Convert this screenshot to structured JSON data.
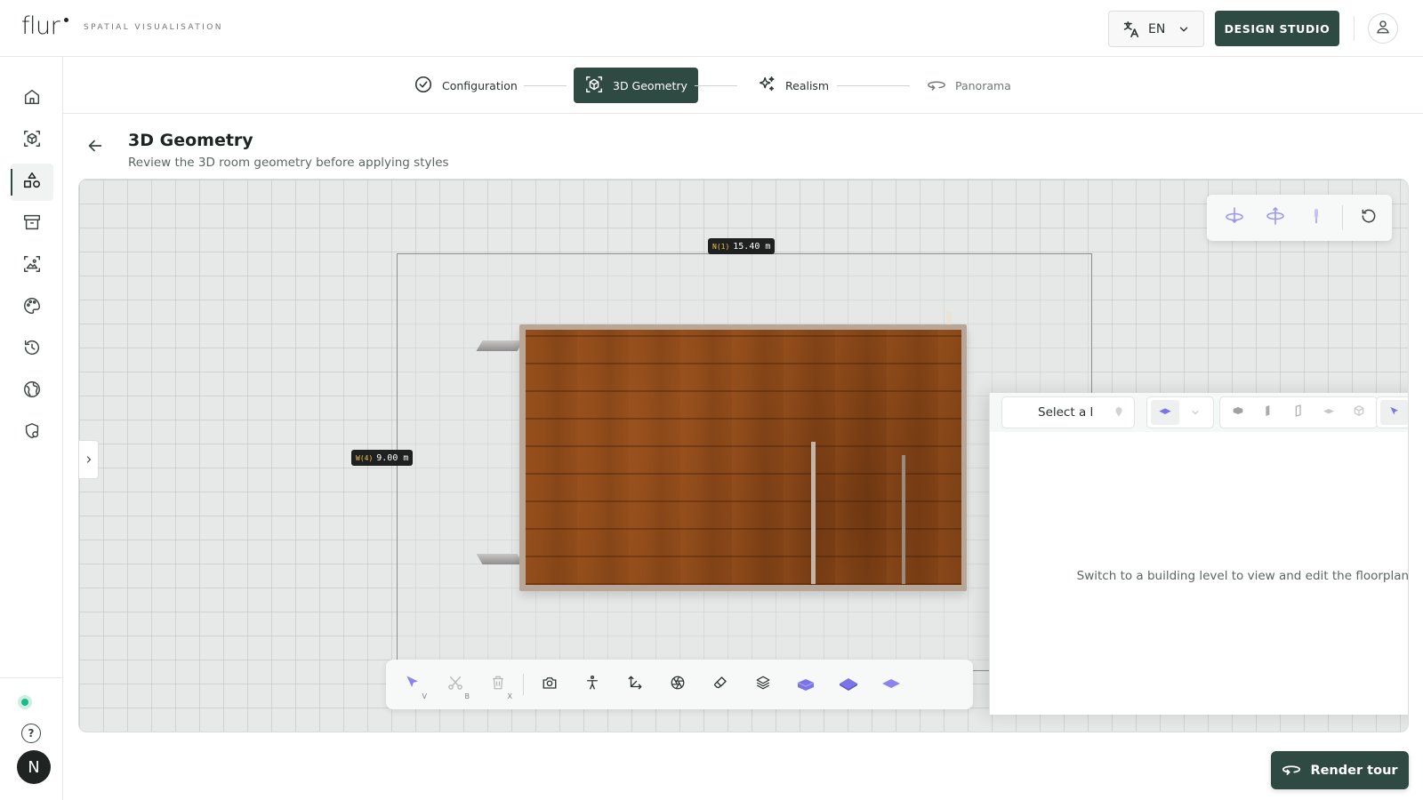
{
  "app": {
    "logo": "flur",
    "tagline": "SPATIAL VISUALISATION"
  },
  "header": {
    "language": "EN",
    "design_studio": "DESIGN STUDIO"
  },
  "sidebar": {
    "items": [
      {
        "icon": "home-icon"
      },
      {
        "icon": "cube-scan-icon"
      },
      {
        "icon": "shapes-icon",
        "active": true
      },
      {
        "icon": "archive-icon"
      },
      {
        "icon": "image-edit-icon"
      },
      {
        "icon": "palette-icon"
      },
      {
        "icon": "history-icon"
      },
      {
        "icon": "globe-icon"
      },
      {
        "icon": "shield-settings-icon"
      }
    ],
    "avatar_initial": "N"
  },
  "stepper": {
    "steps": [
      {
        "label": "Configuration",
        "state": "done"
      },
      {
        "label": "3D Geometry",
        "state": "active"
      },
      {
        "label": "Realism",
        "state": "upcoming"
      },
      {
        "label": "Panorama",
        "state": "upcoming"
      }
    ]
  },
  "page": {
    "title": "3D Geometry",
    "subtitle": "Review the 3D room geometry before applying styles"
  },
  "viewport": {
    "dims": {
      "top": {
        "tag": "N(1)",
        "value": "15.40 m"
      },
      "left": {
        "tag": "W(4)",
        "value": "9.00 m"
      }
    },
    "toolbar_keys": {
      "select": "V",
      "cut": "B",
      "delete": "X"
    }
  },
  "floorplan": {
    "level_placeholder": "Select a l",
    "message": "Switch to a building level to view and edit the floorplan."
  },
  "actions": {
    "render_tour": "Render tour"
  },
  "colors": {
    "brand": "#2f4a43",
    "accent_purple": "#7b74e8"
  }
}
